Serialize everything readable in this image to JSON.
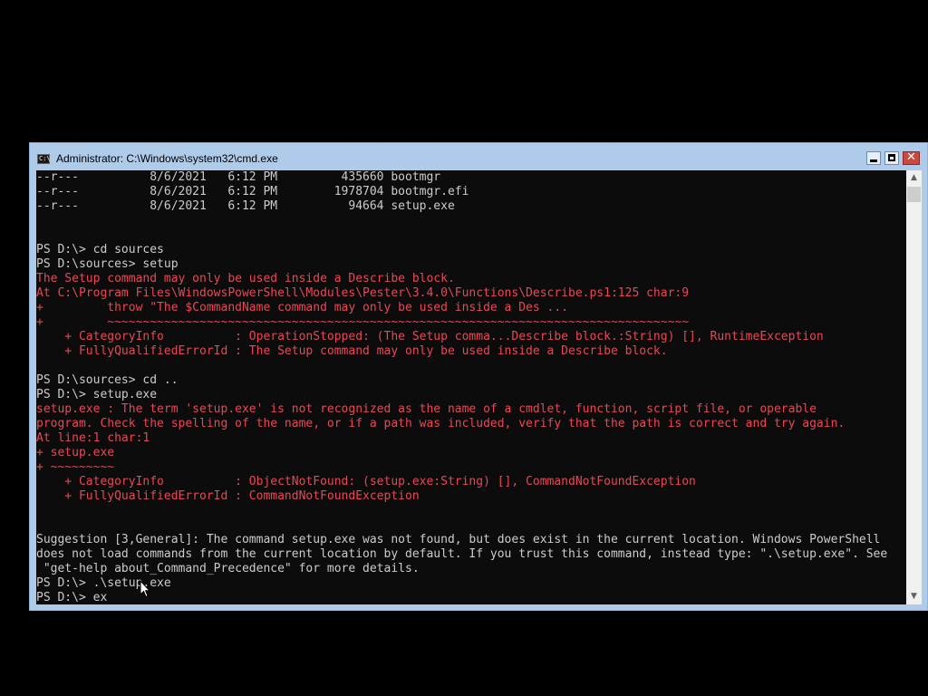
{
  "window": {
    "title": "Administrator: C:\\Windows\\system32\\cmd.exe",
    "icon": "cmd-icon"
  },
  "console": {
    "lines": [
      {
        "text": "--r---          8/6/2021   6:12 PM         435660 bootmgr",
        "color": "w"
      },
      {
        "text": "--r---          8/6/2021   6:12 PM        1978704 bootmgr.efi",
        "color": "w"
      },
      {
        "text": "--r---          8/6/2021   6:12 PM          94664 setup.exe",
        "color": "w"
      },
      {
        "text": "",
        "color": "w"
      },
      {
        "text": "",
        "color": "w"
      },
      {
        "text": "PS D:\\> cd sources",
        "color": "w"
      },
      {
        "text": "PS D:\\sources> setup",
        "color": "w"
      },
      {
        "text": "The Setup command may only be used inside a Describe block.",
        "color": "r"
      },
      {
        "text": "At C:\\Program Files\\WindowsPowerShell\\Modules\\Pester\\3.4.0\\Functions\\Describe.ps1:125 char:9",
        "color": "r"
      },
      {
        "text": "+         throw \"The $CommandName command may only be used inside a Des ...",
        "color": "r"
      },
      {
        "text": "+         ~~~~~~~~~~~~~~~~~~~~~~~~~~~~~~~~~~~~~~~~~~~~~~~~~~~~~~~~~~~~~~~~~~~~~~~~~~~~~~~~~~",
        "color": "r"
      },
      {
        "text": "    + CategoryInfo          : OperationStopped: (The Setup comma...Describe block.:String) [], RuntimeException",
        "color": "r"
      },
      {
        "text": "    + FullyQualifiedErrorId : The Setup command may only be used inside a Describe block.",
        "color": "r"
      },
      {
        "text": "",
        "color": "w"
      },
      {
        "text": "PS D:\\sources> cd ..",
        "color": "w"
      },
      {
        "text": "PS D:\\> setup.exe",
        "color": "w"
      },
      {
        "text": "setup.exe : The term 'setup.exe' is not recognized as the name of a cmdlet, function, script file, or operable",
        "color": "r"
      },
      {
        "text": "program. Check the spelling of the name, or if a path was included, verify that the path is correct and try again.",
        "color": "r"
      },
      {
        "text": "At line:1 char:1",
        "color": "r"
      },
      {
        "text": "+ setup.exe",
        "color": "r"
      },
      {
        "text": "+ ~~~~~~~~~",
        "color": "r"
      },
      {
        "text": "    + CategoryInfo          : ObjectNotFound: (setup.exe:String) [], CommandNotFoundException",
        "color": "r"
      },
      {
        "text": "    + FullyQualifiedErrorId : CommandNotFoundException",
        "color": "r"
      },
      {
        "text": "",
        "color": "w"
      },
      {
        "text": "",
        "color": "w"
      },
      {
        "text": "Suggestion [3,General]: The command setup.exe was not found, but does exist in the current location. Windows PowerShell",
        "color": "w"
      },
      {
        "text": "does not load commands from the current location by default. If you trust this command, instead type: \".\\setup.exe\". See",
        "color": "w"
      },
      {
        "text": " \"get-help about_Command_Precedence\" for more details.",
        "color": "w"
      },
      {
        "text": "PS D:\\> .\\setup.exe",
        "color": "w"
      },
      {
        "text": "PS D:\\> ex",
        "color": "w"
      }
    ]
  },
  "scrollbar": {
    "up_icon": "scroll-up-arrow-icon",
    "down_icon": "scroll-down-arrow-icon"
  }
}
